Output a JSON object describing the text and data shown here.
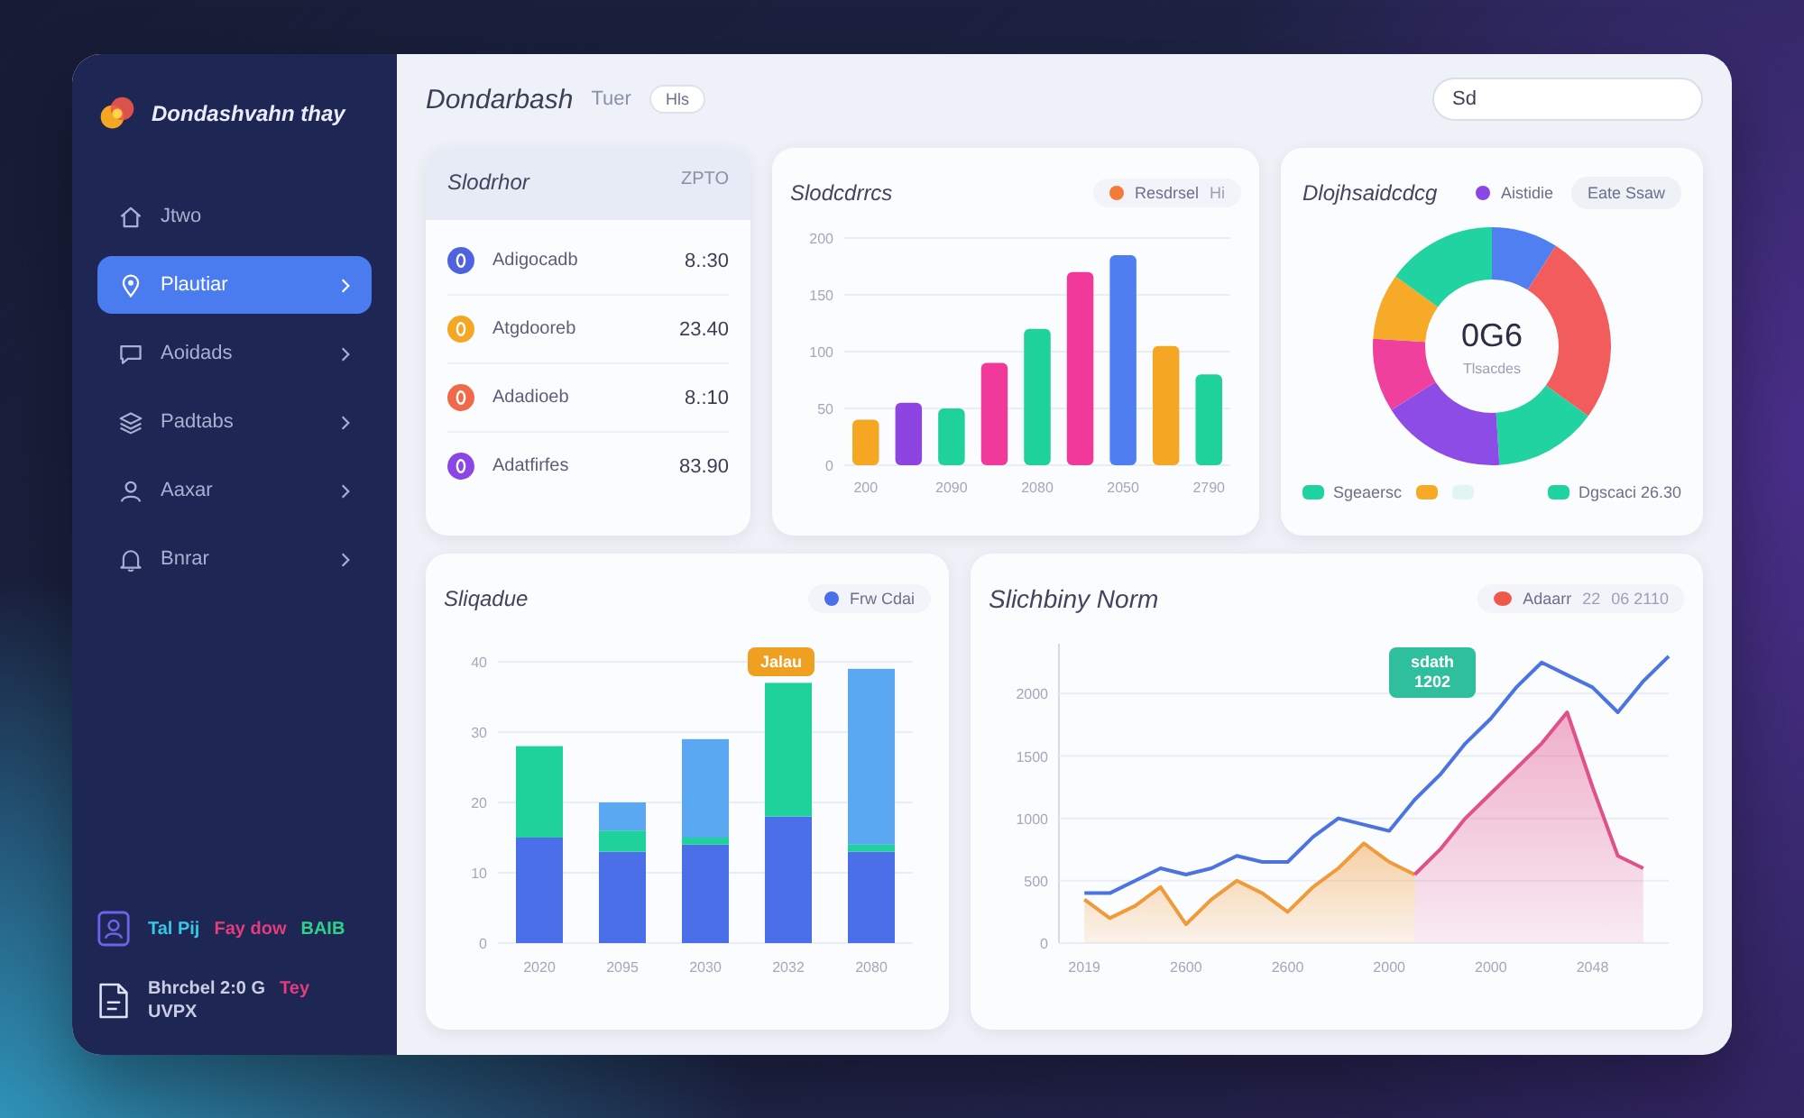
{
  "sidebar": {
    "logo": "Dondashvahn thay",
    "items": [
      {
        "label": "Jtwo",
        "selected": false,
        "expandable": false
      },
      {
        "label": "Plautiar",
        "selected": true,
        "expandable": true
      },
      {
        "label": "Aoidads",
        "selected": false,
        "expandable": true
      },
      {
        "label": "Padtabs",
        "selected": false,
        "expandable": true
      },
      {
        "label": "Aaxar",
        "selected": false,
        "expandable": true
      },
      {
        "label": "Bnrar",
        "selected": false,
        "expandable": true
      }
    ],
    "footer": [
      {
        "lines": [
          {
            "text": "Tal Pij",
            "color": "#36c9e6"
          },
          {
            "text": "Fay dow",
            "color": "#e23d7c"
          },
          {
            "text": "BAIB",
            "color": "#2fd08a"
          }
        ]
      },
      {
        "lines": [
          {
            "text": "Bhrcbel 2:0 G",
            "color": "#c9cde3"
          },
          {
            "text": "Tey",
            "color": "#e23d7c"
          },
          {
            "text": "UVPX",
            "color": "#c9cde3"
          }
        ]
      }
    ]
  },
  "header": {
    "title": "Dondarbash",
    "subtitle": "Tuer",
    "chip": "Hls",
    "search": {
      "value": "Sd"
    }
  },
  "summary_card": {
    "title": "Slodrhor",
    "total": "ZPTO",
    "rows": [
      {
        "name": "Adigocadb",
        "amount": "8.:30",
        "color": "#4f63e0"
      },
      {
        "name": "Atgdooreb",
        "amount": "23.40",
        "color": "#f5a623"
      },
      {
        "name": "Adadioeb",
        "amount": "8.:10",
        "color": "#f06a4a"
      },
      {
        "name": "Adatfirfes",
        "amount": "83.90",
        "color": "#8b46e6"
      }
    ]
  },
  "bar_card": {
    "title": "Slodcdrrcs",
    "legend": {
      "label": "Resdrsel",
      "color": "#f47a3a",
      "note": "Hi"
    },
    "chart_data": {
      "type": "bar",
      "categories": [
        "200",
        null,
        "2090",
        null,
        "2080",
        null,
        "2050",
        null,
        "2790"
      ],
      "values": [
        40,
        55,
        50,
        90,
        120,
        170,
        185,
        105,
        80
      ],
      "colors": [
        "#f5a623",
        "#8e44e0",
        "#1fd19b",
        "#f0399a",
        "#1fd19b",
        "#f0399a",
        "#4e7ef0",
        "#f5a623",
        "#1fd19b"
      ],
      "ylim": [
        0,
        200
      ],
      "yticks": [
        0,
        50,
        100,
        150,
        200
      ],
      "grid": true
    }
  },
  "donut_card": {
    "title": "Dlojhsaidcdcg",
    "legend": {
      "label": "Aistidie",
      "color": "#8b46e6"
    },
    "filter": "Eate Ssaw",
    "center_value": "0G6",
    "center_label": "Tlsacdes",
    "chart_data": {
      "type": "donut",
      "values": [
        9,
        26,
        14,
        17,
        10,
        9,
        15
      ],
      "colors": [
        "#4f7ff0",
        "#f25c5c",
        "#20d3a0",
        "#8d4ce6",
        "#f0409e",
        "#f7a928",
        "#20d3a0"
      ]
    },
    "key": [
      {
        "label": "Sgeaersc",
        "color": "#20d3a0"
      },
      {
        "color": "#f7a928"
      },
      {
        "color": "#e2f5f0"
      },
      {
        "label": "Dgscaci 26.30",
        "color": "#20d3a0"
      }
    ]
  },
  "mix_card": {
    "title": "Sliqadue",
    "chart_data": {
      "type": "bar",
      "stacked": true,
      "categories": [
        "2020",
        "2095",
        "2030",
        "2032",
        "2080"
      ],
      "series": [
        {
          "name": "Frw Cdai",
          "color": "#4b6fe8",
          "values": [
            15,
            13,
            14,
            18,
            13
          ]
        },
        {
          "color": "#1fd19b",
          "values": [
            13,
            3,
            1,
            19,
            1
          ]
        },
        {
          "color": "#5aa8f2",
          "values": [
            0,
            4,
            14,
            0,
            25
          ]
        }
      ],
      "ylim": [
        0,
        40
      ],
      "yticks": [
        0,
        10,
        20,
        30,
        40
      ],
      "grid": true,
      "annotations": [
        {
          "x": "2032",
          "y": 37,
          "text": "Jalau"
        }
      ]
    }
  },
  "line_card": {
    "title": "Slichbiny Norm",
    "legend": {
      "label": "Adaarr",
      "color": "#f0584a",
      "notes": [
        "22",
        "06 2110"
      ]
    },
    "chart_data": {
      "type": "line",
      "categories": [
        null,
        "2019",
        null,
        null,
        null,
        "2600",
        null,
        null,
        null,
        "2600",
        null,
        null,
        null,
        "2000",
        null,
        null,
        null,
        "2000",
        null,
        null,
        null,
        "2048",
        null,
        null,
        null
      ],
      "series": [
        {
          "color": "#4b74e0",
          "type": "line",
          "values": [
            null,
            400,
            400,
            500,
            600,
            550,
            600,
            700,
            650,
            650,
            850,
            1000,
            950,
            900,
            1150,
            1350,
            1600,
            1800,
            2050,
            2250,
            2150,
            2050,
            1850,
            2100,
            2300
          ]
        },
        {
          "color": "#f09a3a",
          "type": "area",
          "values": [
            null,
            350,
            200,
            300,
            450,
            150,
            350,
            500,
            400,
            250,
            450,
            600,
            800,
            650,
            550,
            null,
            null,
            null,
            null,
            null,
            null,
            null,
            null,
            null,
            null
          ]
        },
        {
          "color": "#e0508a",
          "type": "area",
          "values": [
            null,
            null,
            null,
            null,
            null,
            null,
            null,
            null,
            null,
            null,
            null,
            null,
            null,
            null,
            550,
            750,
            1000,
            1200,
            1400,
            1600,
            1850,
            1250,
            700,
            600,
            null
          ]
        }
      ],
      "ylim": [
        0,
        2400
      ],
      "yticks": [
        0,
        500,
        1000,
        1500,
        2000
      ],
      "grid": true,
      "annotations": [
        "sdath 1202"
      ]
    }
  }
}
